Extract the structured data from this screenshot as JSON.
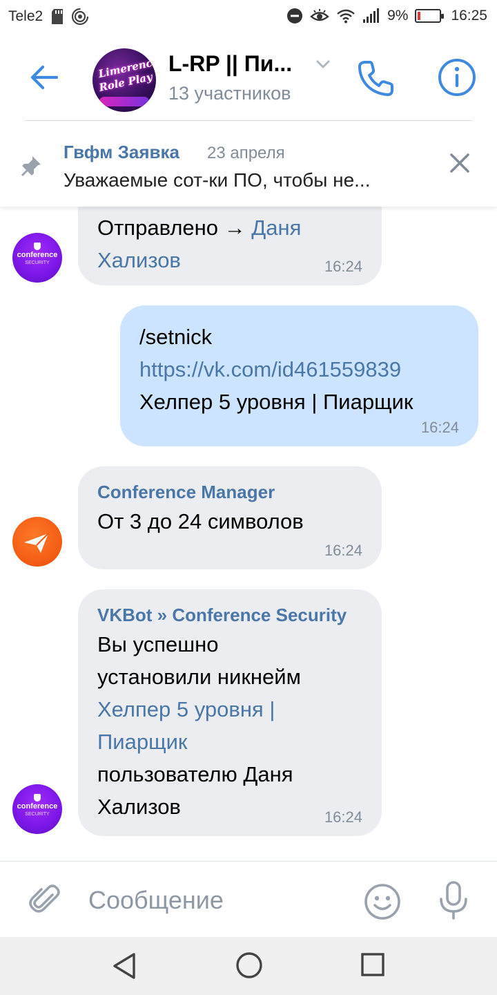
{
  "status_bar": {
    "carrier": "Tele2",
    "battery": "9%",
    "battery_level": 0.09,
    "time": "16:25"
  },
  "header": {
    "title": "L-RP || Пи...",
    "subtitle": "13 участников",
    "avatar_text_1": "Limerence",
    "avatar_text_2": "Role Play",
    "accent_color": "#4a76a8"
  },
  "pinned": {
    "author": "Гвфм Заявка",
    "date": "23 апреля",
    "text": "Уважаемые сот-ки ПО, чтобы не..."
  },
  "messages": [
    {
      "direction": "in",
      "avatar": "conference-security",
      "text_parts": [
        "Отправлено → ",
        "Даня",
        "Хализов"
      ],
      "time": "16:24"
    },
    {
      "direction": "out",
      "lines": [
        "/setnick",
        "https://vk.com/id461559839",
        "Хелпер 5 уровня | Пиарщик"
      ],
      "time": "16:24"
    },
    {
      "direction": "in",
      "avatar": "conference-manager",
      "sender": "Conference Manager",
      "text": "От 3 до 24 символов",
      "time": "16:24"
    },
    {
      "direction": "in",
      "avatar": "conference-security",
      "sender": "VKBot » Conference Security",
      "lines": [
        "Вы успешно",
        "установили никнейм",
        "Хелпер 5 уровня |",
        "Пиарщик",
        "пользователю Даня",
        "Хализов"
      ],
      "time": "16:24"
    }
  ],
  "avatars": {
    "security_title": "conference",
    "security_sub": "SECURITY"
  },
  "composer": {
    "placeholder": "Сообщение"
  }
}
